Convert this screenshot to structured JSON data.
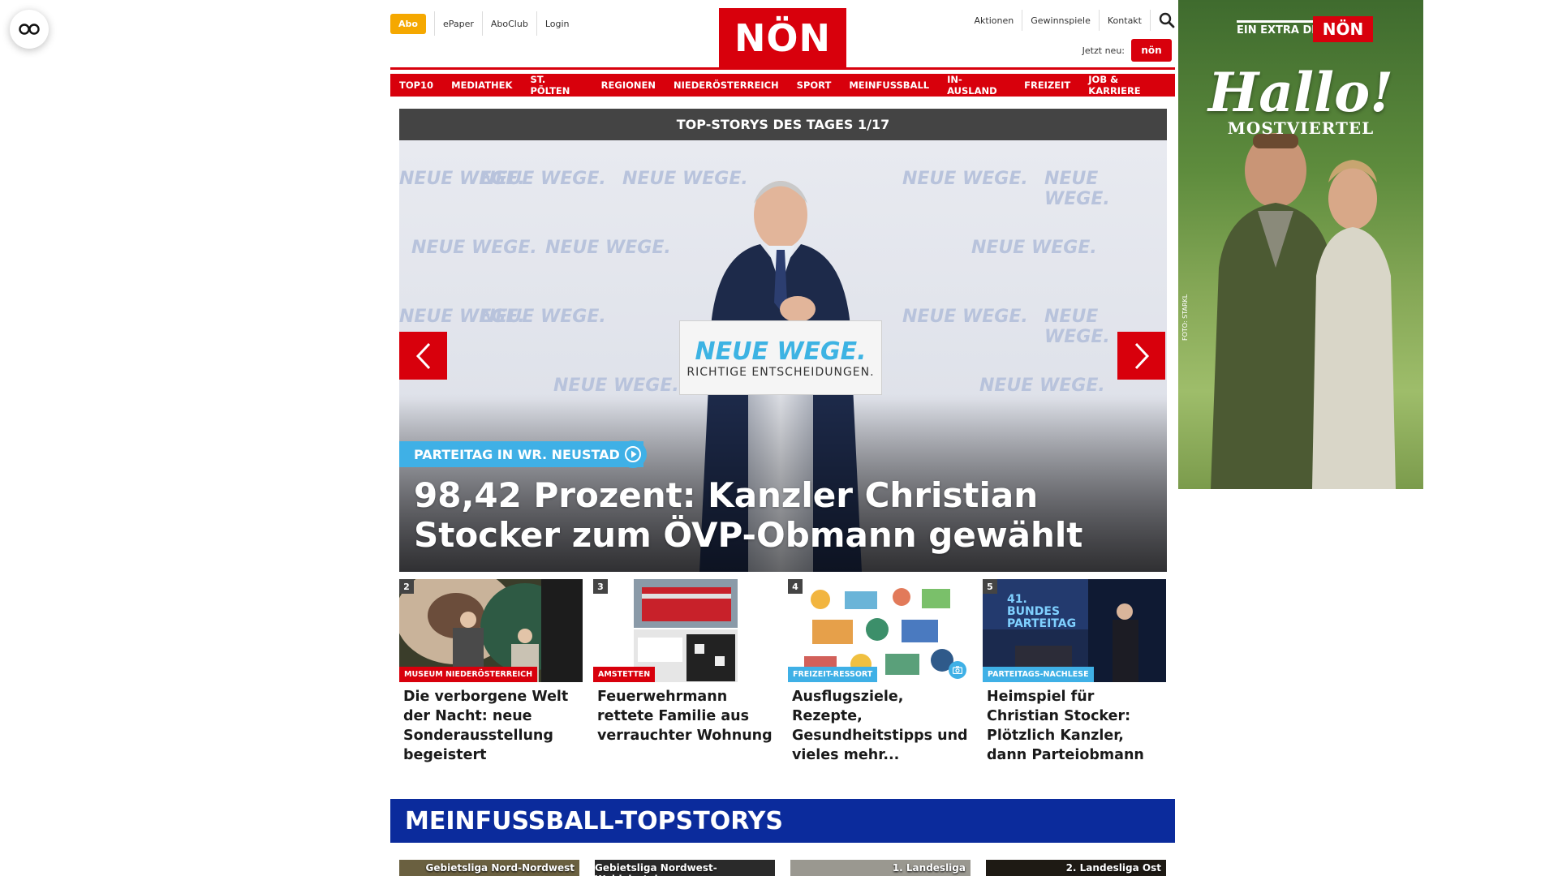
{
  "header": {
    "abo": "Abo",
    "top_links": [
      "ePaper",
      "AboClub",
      "Login"
    ],
    "logo": "NÖN",
    "right_links": [
      "Aktionen",
      "Gewinnspiele",
      "Kontakt"
    ],
    "jetzt_label": "Jetzt neu:",
    "jetzt_logo": "nön"
  },
  "nav": [
    "TOP10",
    "MEDIATHEK",
    "ST. PÖLTEN",
    "REGIONEN",
    "NIEDERÖSTERREICH",
    "SPORT",
    "MEINFUSSBALL",
    "IN-AUSLAND",
    "FREIZEIT",
    "JOB & KARRIERE"
  ],
  "topstories": {
    "header": "TOP-STORYS DES TAGES 1/17",
    "hero": {
      "category": "PARTEITAG IN WR. NEUSTADT",
      "title": "98,42 Prozent: Kanzler Christian Stocker zum ÖVP-Obmann gewählt",
      "podium_line1": "NEUE WEGE.",
      "podium_line2": "RICHTIGE ENTSCHEIDUNGEN.",
      "backdrop_text": "NEUE WEGE."
    },
    "items": [
      {
        "num": "2",
        "category": "MUSEUM NIEDERÖSTERREICH",
        "title": "Die verborgene Welt der Nacht: neue Sonderausstellung begeistert"
      },
      {
        "num": "3",
        "category": "AMSTETTEN",
        "title": "Feuerwehrmann rettete Familie aus verrauchter Wohnung"
      },
      {
        "num": "4",
        "category": "FREIZEIT-RESSORT",
        "title": "Ausflugsziele, Rezepte, Gesundheitstipps und vieles mehr..."
      },
      {
        "num": "5",
        "category": "PARTEITAGS-NACHLESE",
        "title": "Heimspiel für Christian Stocker: Plötzlich Kanzler, dann Parteiobmann"
      }
    ],
    "item5_sign": "41. BUNDES PARTEITAG"
  },
  "meinfussball": {
    "title": "MEINFUSSBALL-TOPSTORYS",
    "leagues": [
      "Gebietsliga Nord-Nordwest",
      "Gebietsliga Nordwest-Waldviertel",
      "1. Landesliga",
      "2. Landesliga Ost"
    ]
  },
  "ad": {
    "extra": "EIN EXTRA DER",
    "logo": "NÖN",
    "headline": "Hallo!",
    "region": "MOSTVIERTEL",
    "credit": "FOTO: STARKL"
  },
  "colors": {
    "brand_red": "#d8000c",
    "abo_orange": "#f5a800",
    "category_blue": "#3fb0e6",
    "meinfussball_blue": "#0b2b9c"
  }
}
